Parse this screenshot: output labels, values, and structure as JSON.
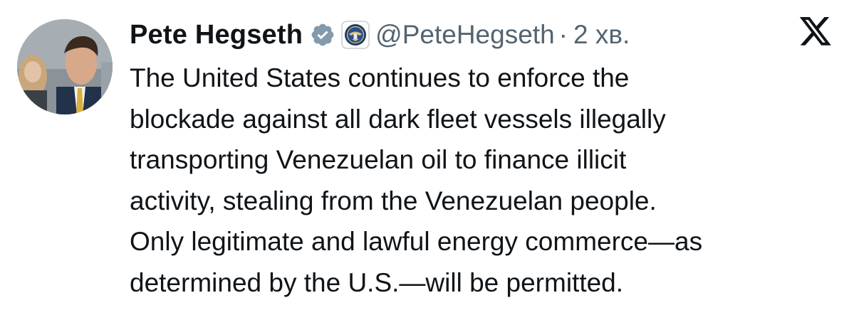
{
  "post": {
    "author_name": "Pete Hegseth",
    "handle": "@PeteHegseth",
    "separator": "·",
    "time": "2 хв.",
    "text": "The United States continues to enforce the\nblockade against all dark fleet vessels illegally\ntransporting Venezuelan oil to finance illicit\nactivity, stealing from the Venezuelan people.\nOnly legitimate and lawful energy commerce—as\ndetermined by the U.S.—will be permitted."
  },
  "icons": {
    "verified": "verified-badge-icon",
    "affiliation": "department-seal-icon",
    "platform": "x-logo-icon",
    "avatar": "avatar"
  },
  "colors": {
    "text": "#0f1419",
    "secondary_text": "#536471",
    "verified_badge": "#829aab",
    "background": "#ffffff"
  }
}
